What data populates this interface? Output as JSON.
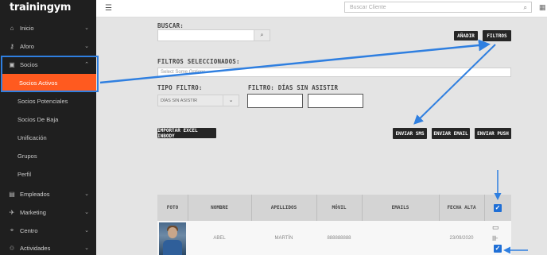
{
  "app": {
    "logo": "trainingym"
  },
  "sidebar": {
    "items": [
      {
        "label": "Inicio",
        "icon": "home-icon",
        "glyph": "⌂",
        "chevron": "⌄"
      },
      {
        "label": "Aforo",
        "icon": "key-icon",
        "glyph": "⚷",
        "chevron": "⌄"
      },
      {
        "label": "Socios",
        "icon": "id-card-icon",
        "glyph": "▣",
        "chevron": "⌃"
      }
    ],
    "socios_sub": [
      {
        "label": "Socios Activos"
      },
      {
        "label": "Socios Potenciales"
      },
      {
        "label": "Socios De Baja"
      },
      {
        "label": "Unificación"
      },
      {
        "label": "Grupos"
      },
      {
        "label": "Perfil"
      }
    ],
    "bottom_items": [
      {
        "label": "Empleados",
        "icon": "employees-icon",
        "glyph": "▤",
        "chevron": "⌄"
      },
      {
        "label": "Marketing",
        "icon": "megaphone-icon",
        "glyph": "✈",
        "chevron": "⌄"
      },
      {
        "label": "Centro",
        "icon": "location-pin-icon",
        "glyph": "⌖",
        "chevron": "⌄"
      },
      {
        "label": "Actividades",
        "icon": "activities-icon",
        "glyph": "♲",
        "chevron": "⌄"
      }
    ]
  },
  "topbar": {
    "menu_glyph": "☰",
    "search_placeholder": "Buscar Cliente",
    "search_glyph": "⌕",
    "calendar_glyph": "▦"
  },
  "filters": {
    "buscar_label": "BUSCAR:",
    "buscar_value": "",
    "search_glyph": "⌕",
    "anadir_label": "AÑADIR",
    "filtros_label": "FILTROS",
    "seleccionados_label": "FILTROS SELECCIONADOS:",
    "seleccionados_placeholder": "Select Some Options",
    "tipo_label": "TIPO FILTRO:",
    "tipo_value": "DÍAS SIN ASISTIR",
    "tipo_chevron": "⌄",
    "dias_label": "FILTRO: DÍAS SIN ASISTIR",
    "dias_from": "",
    "dias_to": ""
  },
  "actions": {
    "importar": "IMPORTAR EXCEL INBODY",
    "sms": "ENVIAR SMS",
    "email": "ENVIAR EMAIL",
    "push": "ENVIAR PUSH"
  },
  "table": {
    "headers": [
      "FOTO",
      "NOMBRE",
      "APELLIDOS",
      "MÓVIL",
      "EMAILS",
      "FECHA ALTA"
    ],
    "check_glyph": "✓",
    "rows": [
      {
        "nombre": "ABEL",
        "apellidos": "MARTÍN",
        "movil": "888888888",
        "emails": "",
        "fecha_alta": "23/09/2020",
        "row_icons": [
          "notebook-icon",
          "dumbbell-icon"
        ],
        "notebook_glyph": "▭",
        "dumbbell_glyph": "⊪"
      }
    ]
  },
  "colors": {
    "accent": "#ff5a1f",
    "annotation": "#2f7fe0",
    "sidebar": "#1f1f1f",
    "checkbox": "#1f6fd6"
  }
}
